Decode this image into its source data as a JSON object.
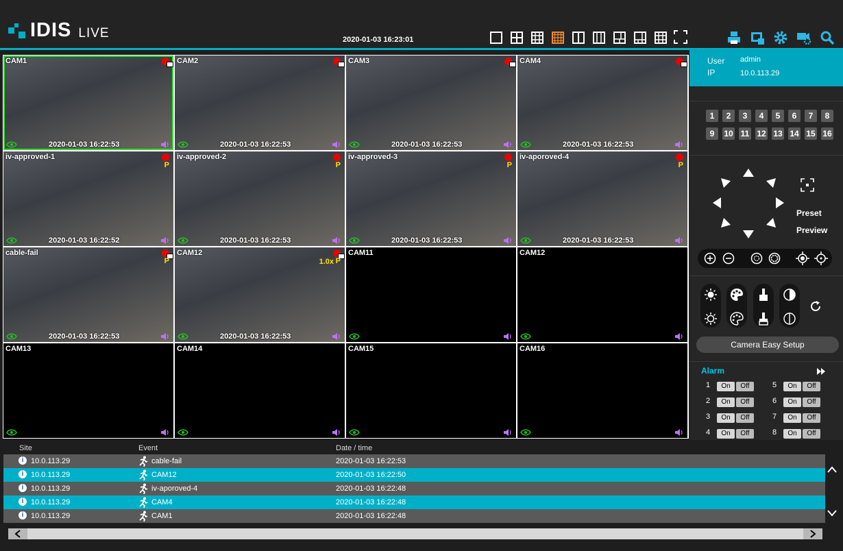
{
  "header": {
    "brand": "IDIS",
    "mode": "LIVE",
    "datetime": "2020-01-03 16:23:01",
    "accent": "#00aec8",
    "layout_icons": [
      "layout-1x1-icon",
      "layout-2x2-icon",
      "layout-3x3-icon",
      "layout-4x4-icon",
      "layout-1x2-icon",
      "layout-1x3-icon",
      "layout-1plus3-icon",
      "layout-1plus5-icon",
      "layout-1plus7-icon",
      "fullscreen-icon"
    ],
    "selected_layout": "layout-4x4-icon",
    "tool_icons": [
      "print-icon",
      "snapshot-icon",
      "settings-gear-icon",
      "camera-settings-icon",
      "search-icon"
    ]
  },
  "cameras": [
    {
      "name": "CAM1",
      "ts": "2020-01-03 16:22:53",
      "live": true,
      "rec": "menu",
      "selected": true
    },
    {
      "name": "CAM2",
      "ts": "2020-01-03 16:22:53",
      "live": true,
      "rec": "menu"
    },
    {
      "name": "CAM3",
      "ts": "2020-01-03 16:22:53",
      "live": true,
      "rec": "menu"
    },
    {
      "name": "CAM4",
      "ts": "2020-01-03 16:22:53",
      "live": true,
      "rec": "menu"
    },
    {
      "name": "iv-approved-1",
      "ts": "2020-01-03 16:22:52",
      "live": true,
      "rec": "dot",
      "p": "P"
    },
    {
      "name": "iv-approved-2",
      "ts": "2020-01-03 16:22:53",
      "live": true,
      "rec": "dot",
      "p": "P"
    },
    {
      "name": "iv-approved-3",
      "ts": "2020-01-03 16:22:53",
      "live": true,
      "rec": "dot",
      "p": "P"
    },
    {
      "name": "iv-aporoved-4",
      "ts": "2020-01-03 16:22:53",
      "live": true,
      "rec": "dot",
      "p": "P"
    },
    {
      "name": "cable-fail",
      "ts": "2020-01-03 16:22:53",
      "live": true,
      "rec": "menu",
      "p": "P"
    },
    {
      "name": "CAM12",
      "ts": "2020-01-03 16:22:53",
      "live": true,
      "rec": "menu",
      "p": "P",
      "zoom": "1.0x"
    },
    {
      "name": "CAM11",
      "ts": "",
      "live": false
    },
    {
      "name": "CAM12",
      "ts": "",
      "live": false
    },
    {
      "name": "CAM13",
      "ts": "",
      "live": false
    },
    {
      "name": "CAM14",
      "ts": "",
      "live": false
    },
    {
      "name": "CAM15",
      "ts": "",
      "live": false
    },
    {
      "name": "CAM16",
      "ts": "",
      "live": false
    }
  ],
  "side": {
    "user_label": "User",
    "user_value": "admin",
    "ip_label": "IP",
    "ip_value": "10.0.113.29",
    "channels": [
      "1",
      "2",
      "3",
      "4",
      "5",
      "6",
      "7",
      "8",
      "9",
      "10",
      "11",
      "12",
      "13",
      "14",
      "15",
      "16"
    ],
    "preset_label": "Preset",
    "preview_label": "Preview",
    "easy_setup_label": "Camera Easy Setup",
    "alarm_title": "Alarm",
    "alarms": [
      {
        "n": "1",
        "on": "On",
        "off": "Off"
      },
      {
        "n": "2",
        "on": "On",
        "off": "Off"
      },
      {
        "n": "3",
        "on": "On",
        "off": "Off"
      },
      {
        "n": "4",
        "on": "On",
        "off": "Off"
      },
      {
        "n": "5",
        "on": "On",
        "off": "Off"
      },
      {
        "n": "6",
        "on": "On",
        "off": "Off"
      },
      {
        "n": "7",
        "on": "On",
        "off": "Off"
      },
      {
        "n": "8",
        "on": "On",
        "off": "Off"
      }
    ]
  },
  "events": {
    "headers": {
      "site": "Site",
      "event": "Event",
      "datetime": "Date / time"
    },
    "rows": [
      {
        "site": "10.0.113.29",
        "event": "cable-fail",
        "datetime": "2020-01-03 16:22:53"
      },
      {
        "site": "10.0.113.29",
        "event": "CAM12",
        "datetime": "2020-01-03 16:22:50"
      },
      {
        "site": "10.0.113.29",
        "event": "iv-aporoved-4",
        "datetime": "2020-01-03 16:22:48"
      },
      {
        "site": "10.0.113.29",
        "event": "CAM4",
        "datetime": "2020-01-03 16:22:48"
      },
      {
        "site": "10.0.113.29",
        "event": "CAM1",
        "datetime": "2020-01-03 16:22:48"
      }
    ]
  }
}
